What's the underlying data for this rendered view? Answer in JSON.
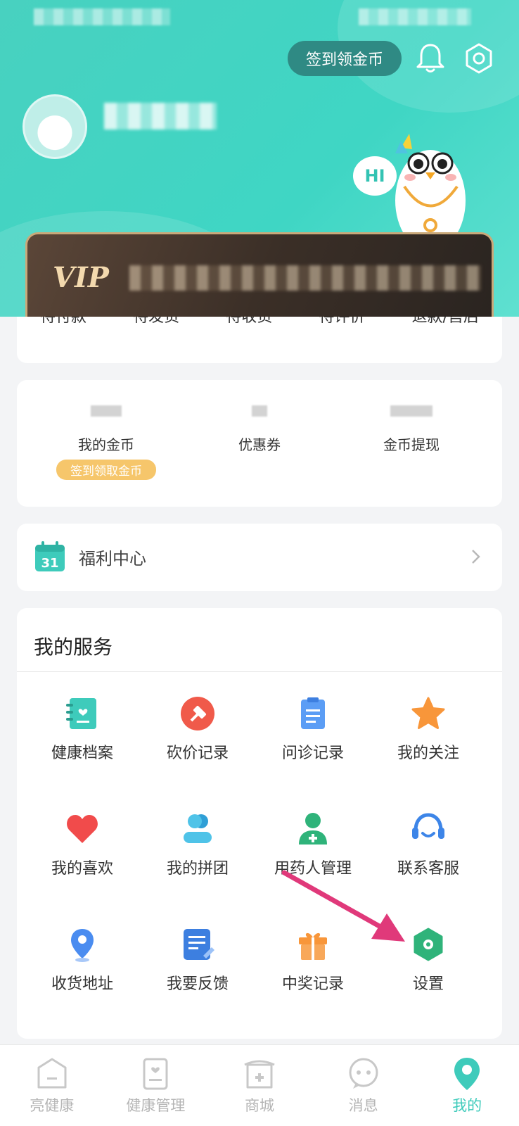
{
  "header": {
    "signin_button": "签到领金币",
    "hi_text": "HI",
    "vip_label": "VIP"
  },
  "orders": {
    "tabs": [
      "待付款",
      "待发货",
      "待收货",
      "待评价",
      "退款/售后"
    ]
  },
  "coins": {
    "items": [
      {
        "label": "我的金币",
        "badge": "签到领取金币"
      },
      {
        "label": "优惠券"
      },
      {
        "label": "金币提现"
      }
    ]
  },
  "welfare": {
    "calendar_day": "31",
    "label": "福利中心"
  },
  "services": {
    "title": "我的服务",
    "items": [
      {
        "label": "健康档案",
        "icon": "health-record-icon"
      },
      {
        "label": "砍价记录",
        "icon": "bargain-icon"
      },
      {
        "label": "问诊记录",
        "icon": "consultation-icon"
      },
      {
        "label": "我的关注",
        "icon": "star-icon"
      },
      {
        "label": "我的喜欢",
        "icon": "heart-icon"
      },
      {
        "label": "我的拼团",
        "icon": "group-icon"
      },
      {
        "label": "用药人管理",
        "icon": "patient-icon"
      },
      {
        "label": "联系客服",
        "icon": "headset-icon"
      },
      {
        "label": "收货地址",
        "icon": "location-icon"
      },
      {
        "label": "我要反馈",
        "icon": "feedback-icon"
      },
      {
        "label": "中奖记录",
        "icon": "gift-icon"
      },
      {
        "label": "设置",
        "icon": "settings-icon"
      }
    ]
  },
  "tabbar": {
    "items": [
      {
        "label": "亮健康"
      },
      {
        "label": "健康管理"
      },
      {
        "label": "商城"
      },
      {
        "label": "消息"
      },
      {
        "label": "我的"
      }
    ]
  },
  "colors": {
    "accent": "#3ecbbb",
    "vip_gold": "#c9a879",
    "badge": "#f6c66b",
    "arrow": "#e0397a"
  }
}
